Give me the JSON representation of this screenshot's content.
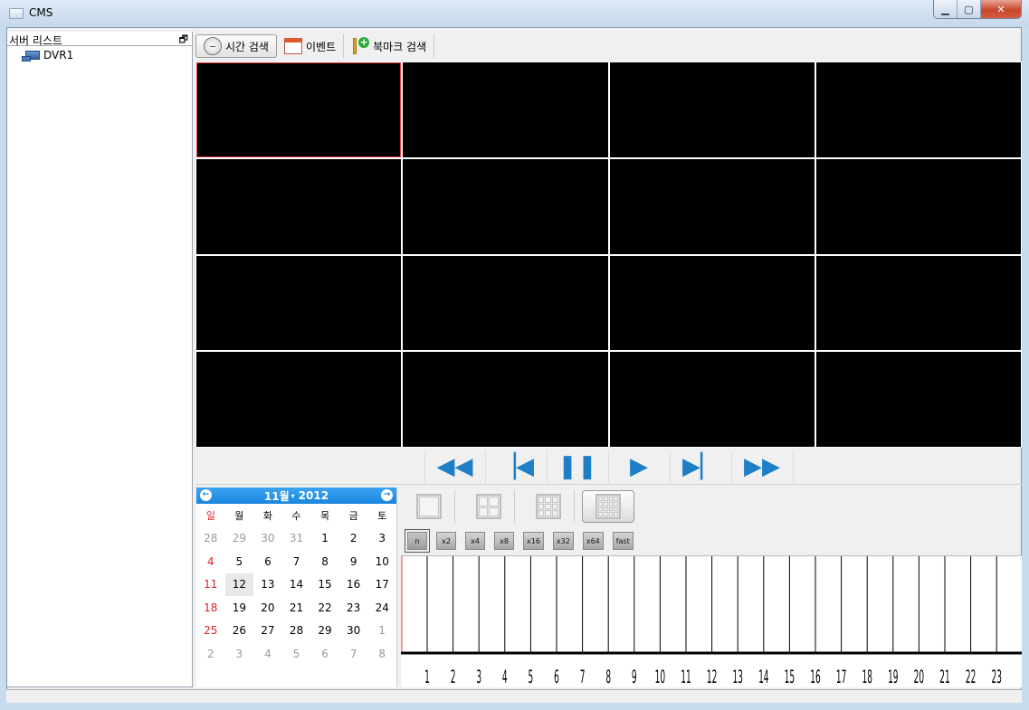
{
  "window": {
    "title": "CMS",
    "min": "▁",
    "max": "▢",
    "close": "✕"
  },
  "sidebar": {
    "title": "서버 리스트",
    "float_icon": "🗗",
    "items": [
      {
        "label": "DVR1",
        "icon": "dvr-icon"
      }
    ]
  },
  "toolbar": {
    "time_search": "시간 검색",
    "event": "이벤트",
    "bookmark_search": "북마크 검색"
  },
  "video_grid": {
    "rows": 4,
    "cols": 4,
    "selected_index": 0
  },
  "playback": {
    "buttons": [
      {
        "name": "rewind-button",
        "glyph": "◀◀"
      },
      {
        "name": "previous-frame-button",
        "glyph": "▕◀"
      },
      {
        "name": "pause-button",
        "glyph": "❚❚"
      },
      {
        "name": "play-button",
        "glyph": "▶"
      },
      {
        "name": "next-frame-button",
        "glyph": "▶▏"
      },
      {
        "name": "fast-forward-button",
        "glyph": "▶▶"
      }
    ]
  },
  "calendar": {
    "month_label": "11월",
    "year_label": "2012",
    "prev": "←",
    "next": "→",
    "weekdays": [
      "일",
      "월",
      "화",
      "수",
      "목",
      "금",
      "토"
    ],
    "weeks": [
      [
        "28",
        "29",
        "30",
        "31",
        "1",
        "2",
        "3"
      ],
      [
        "4",
        "5",
        "6",
        "7",
        "8",
        "9",
        "10"
      ],
      [
        "11",
        "12",
        "13",
        "14",
        "15",
        "16",
        "17"
      ],
      [
        "18",
        "19",
        "20",
        "21",
        "22",
        "23",
        "24"
      ],
      [
        "25",
        "26",
        "27",
        "28",
        "29",
        "30",
        "1"
      ],
      [
        "2",
        "3",
        "4",
        "5",
        "6",
        "7",
        "8"
      ]
    ],
    "today": "12",
    "sunday_color": "#dd2222"
  },
  "layouts": [
    {
      "name": "layout-1x1-button",
      "cols": 1,
      "active": false
    },
    {
      "name": "layout-2x2-button",
      "cols": 2,
      "active": false
    },
    {
      "name": "layout-3x3-button",
      "cols": 3,
      "active": false
    },
    {
      "name": "layout-4x4-button",
      "cols": 4,
      "active": true
    }
  ],
  "speeds": [
    "n",
    "x2",
    "x4",
    "x8",
    "x16",
    "x32",
    "x64",
    "fast"
  ],
  "active_speed": "n",
  "timeline": {
    "hours": [
      "1",
      "2",
      "3",
      "4",
      "5",
      "6",
      "7",
      "8",
      "9",
      "10",
      "11",
      "12",
      "13",
      "14",
      "15",
      "16",
      "17",
      "18",
      "19",
      "20",
      "21",
      "22",
      "23"
    ]
  }
}
